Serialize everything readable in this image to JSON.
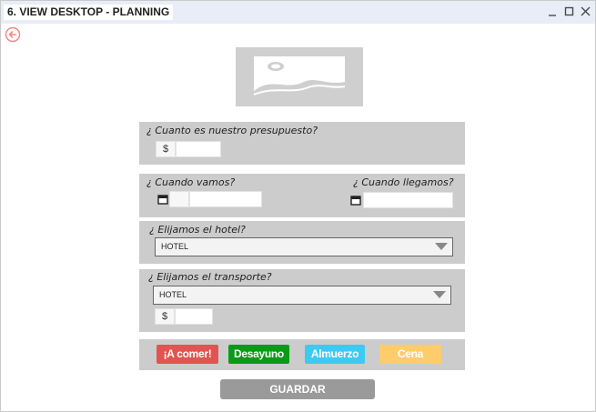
{
  "window": {
    "title": "6. VIEW DESKTOP - PLANNING"
  },
  "budget": {
    "question": "¿ Cuanto es nuestro presupuesto?",
    "currency": "$",
    "value": ""
  },
  "dates": {
    "go_label": "¿ Cuando vamos?",
    "arrive_label": "¿ Cuando llegamos?",
    "go_value": "",
    "arrive_value": ""
  },
  "hotel": {
    "question": "¿ Elijamos el hotel?",
    "selected": "HOTEL"
  },
  "transport": {
    "question": "¿ Elijamos el transporte?",
    "selected": "HOTEL",
    "currency": "$",
    "cost": ""
  },
  "meals": {
    "eat_label": "¡A comer!",
    "breakfast_label": "Desayuno",
    "lunch_label": "Almuerzo",
    "dinner_label": "Cena",
    "colors": {
      "eat": "#e05552",
      "breakfast": "#0b9a17",
      "lunch": "#3ec9f2",
      "dinner": "#ffcc6b"
    }
  },
  "actions": {
    "save_label": "GUARDAR"
  },
  "icons": [
    "back-arrow-icon",
    "image-placeholder-icon",
    "calendar-icon",
    "dropdown-caret-icon",
    "minimize-icon",
    "maximize-icon",
    "close-icon"
  ]
}
